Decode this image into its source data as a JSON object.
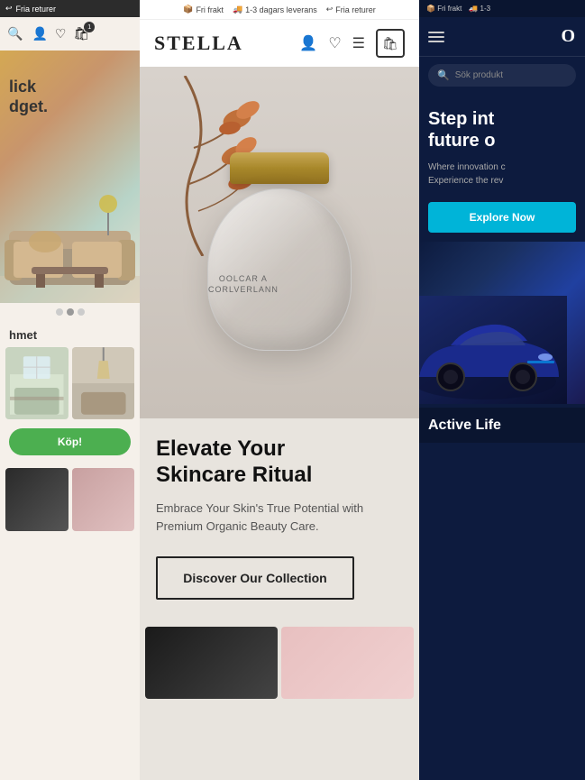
{
  "left_panel": {
    "top_bar_text": "Fria returer",
    "nav_icons": [
      "🔍",
      "👤",
      "♡",
      "🛍"
    ],
    "cart_badge": "1",
    "hero_text_line1": "lick",
    "hero_text_line2": "dget.",
    "dot_count": 3,
    "active_dot": 1,
    "section_title": "hmet",
    "buy_button_label": "Köp!"
  },
  "center_panel": {
    "top_bar_items": [
      "Fri frakt",
      "1-3 dagars leverans",
      "Fria returer"
    ],
    "logo": "STELLA",
    "product_name_line1": "Elevate Your",
    "product_name_line2": "Skincare Ritual",
    "product_desc": "Embrace Your Skin's True Potential with Premium Organic Beauty Care.",
    "jar_label_line1": "OOLCAR A",
    "jar_label_line2": "CORLVERLANN",
    "cta_button": "Discover Our Collection"
  },
  "right_panel": {
    "top_bar_text1": "Fri frakt",
    "top_bar_text2": "1-3",
    "logo": "O",
    "search_placeholder": "Sök produkt",
    "hero_heading_line1": "Step int",
    "hero_heading_line2": "future o",
    "hero_sub_line1": "Where innovation c",
    "hero_sub_line2": "Experience the rev",
    "explore_button": "Explore Now",
    "active_life_title": "Active Life"
  },
  "colors": {
    "left_bg": "#f5f0ea",
    "center_bg": "#e8e4de",
    "right_bg": "#0d1b3e",
    "explore_btn": "#00b4d8",
    "buy_btn": "#4caf50",
    "stella_accent": "#c8a855"
  }
}
